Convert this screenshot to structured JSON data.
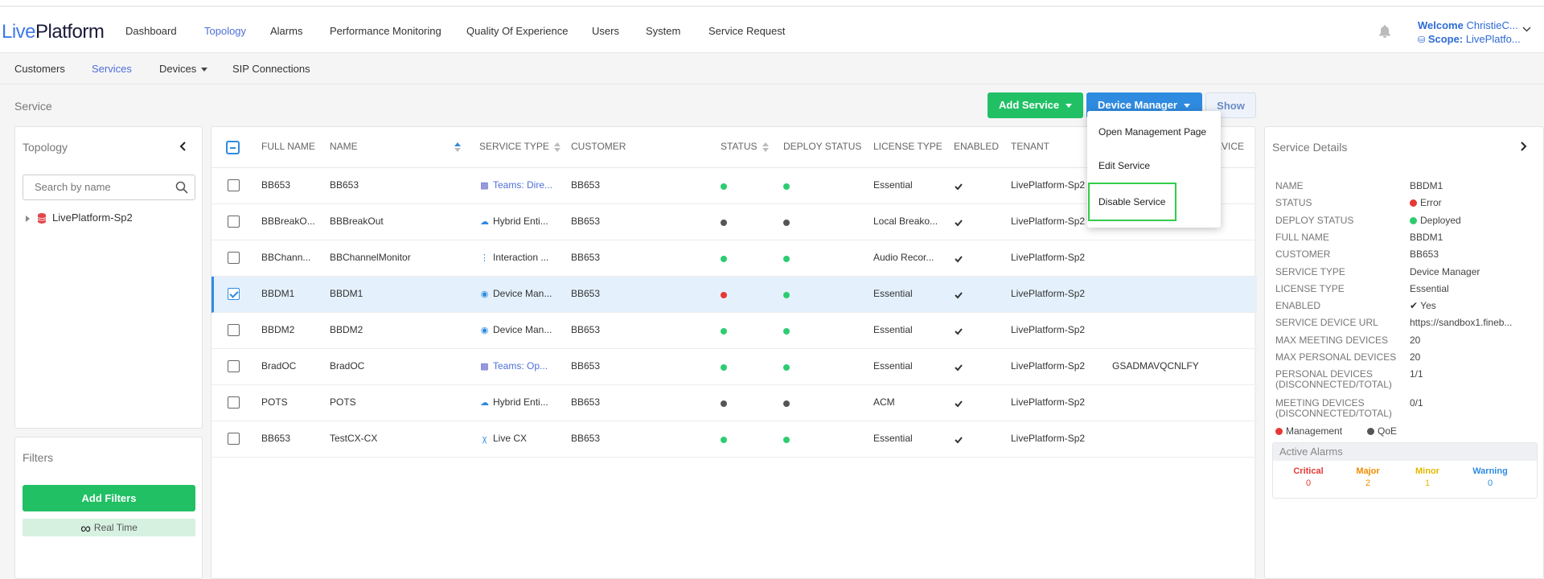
{
  "app": {
    "logo_part1": "Live",
    "logo_part2": "Platform"
  },
  "nav": {
    "items": [
      "Dashboard",
      "Topology",
      "Alarms",
      "Performance Monitoring",
      "Quality Of Experience",
      "Users",
      "System",
      "Service Request"
    ],
    "active": "Topology"
  },
  "user": {
    "welcome_label": "Welcome",
    "name": "ChristieC...",
    "scope_label": "Scope:",
    "scope_value": "LivePlatfo..."
  },
  "subnav": {
    "items": [
      "Customers",
      "Services",
      "Devices",
      "SIP Connections"
    ],
    "active": "Services"
  },
  "page": {
    "title": "Service"
  },
  "toolbar": {
    "add_service": "Add Service",
    "device_manager": "Device Manager",
    "show": "Show"
  },
  "dropdown": {
    "items": [
      "Open Management Page",
      "Edit Service",
      "Disable Service"
    ],
    "highlighted": "Disable Service"
  },
  "topology": {
    "title": "Topology",
    "search_placeholder": "Search by name",
    "tree_root": "LivePlatform-Sp2"
  },
  "filters": {
    "title": "Filters",
    "add_filters": "Add Filters",
    "realtime_icon": "∞",
    "realtime": "Real Time"
  },
  "table": {
    "columns": [
      "FULL NAME",
      "NAME",
      "SERVICE TYPE",
      "CUSTOMER",
      "STATUS",
      "DEPLOY STATUS",
      "LICENSE TYPE",
      "ENABLED",
      "TENANT",
      "EVICE"
    ],
    "rows": [
      {
        "full_name": "BB653",
        "name": "BB653",
        "service_type": "Teams: Dire...",
        "service_icon": "teams-icon",
        "service_link": true,
        "customer": "BB653",
        "status": "green",
        "deploy": "green",
        "license": "Essential",
        "enabled": true,
        "tenant": "LivePlatform-Sp2",
        "extra": "",
        "selected": false
      },
      {
        "full_name": "BBBreakO...",
        "name": "BBBreakOut",
        "service_type": "Hybrid Enti...",
        "service_icon": "cloud-icon",
        "service_link": false,
        "customer": "BB653",
        "status": "gray",
        "deploy": "gray",
        "license": "Local Breako...",
        "enabled": true,
        "tenant": "LivePlatform-Sp2",
        "extra": "",
        "selected": false
      },
      {
        "full_name": "BBChann...",
        "name": "BBChannelMonitor",
        "service_type": "Interaction ...",
        "service_icon": "waveform-icon",
        "service_link": false,
        "customer": "BB653",
        "status": "green",
        "deploy": "green",
        "license": "Audio Recor...",
        "enabled": true,
        "tenant": "LivePlatform-Sp2",
        "extra": "",
        "selected": false
      },
      {
        "full_name": "BBDM1",
        "name": "BBDM1",
        "service_type": "Device Man...",
        "service_icon": "device-manager-icon",
        "service_link": false,
        "customer": "BB653",
        "status": "red",
        "deploy": "green",
        "license": "Essential",
        "enabled": true,
        "tenant": "LivePlatform-Sp2",
        "extra": "",
        "selected": true
      },
      {
        "full_name": "BBDM2",
        "name": "BBDM2",
        "service_type": "Device Man...",
        "service_icon": "device-manager-icon",
        "service_link": false,
        "customer": "BB653",
        "status": "green",
        "deploy": "green",
        "license": "Essential",
        "enabled": true,
        "tenant": "LivePlatform-Sp2",
        "extra": "",
        "selected": false
      },
      {
        "full_name": "BradOC",
        "name": "BradOC",
        "service_type": "Teams: Op...",
        "service_icon": "teams-icon",
        "service_link": true,
        "customer": "BB653",
        "status": "green",
        "deploy": "green",
        "license": "Essential",
        "enabled": true,
        "tenant": "LivePlatform-Sp2",
        "extra": "GSADMAVQCNLFY",
        "selected": false
      },
      {
        "full_name": "POTS",
        "name": "POTS",
        "service_type": "Hybrid Enti...",
        "service_icon": "cloud-icon",
        "service_link": false,
        "customer": "BB653",
        "status": "gray",
        "deploy": "gray",
        "license": "ACM",
        "enabled": true,
        "tenant": "LivePlatform-Sp2",
        "extra": "",
        "selected": false
      },
      {
        "full_name": "BB653",
        "name": "TestCX-CX",
        "service_type": "Live CX",
        "service_icon": "cx-icon",
        "service_link": false,
        "customer": "BB653",
        "status": "green",
        "deploy": "green",
        "license": "Essential",
        "enabled": true,
        "tenant": "LivePlatform-Sp2",
        "extra": "",
        "selected": false
      }
    ]
  },
  "details": {
    "title": "Service Details",
    "fields": [
      {
        "label": "NAME",
        "value": "BBDM1"
      },
      {
        "label": "STATUS",
        "value": "Error",
        "dot": "red"
      },
      {
        "label": "DEPLOY STATUS",
        "value": "Deployed",
        "dot": "green"
      },
      {
        "label": "FULL NAME",
        "value": "BBDM1"
      },
      {
        "label": "CUSTOMER",
        "value": "BB653"
      },
      {
        "label": "SERVICE TYPE",
        "value": "Device Manager"
      },
      {
        "label": "LICENSE TYPE",
        "value": "Essential"
      },
      {
        "label": "ENABLED",
        "value": "Yes",
        "check": true
      },
      {
        "label": "SERVICE DEVICE URL",
        "value": "https://sandbox1.fineb..."
      },
      {
        "label": "MAX MEETING DEVICES",
        "value": "20"
      },
      {
        "label": "MAX PERSONAL DEVICES",
        "value": "20"
      },
      {
        "label": "PERSONAL DEVICES",
        "label2": "(DISCONNECTED/TOTAL)",
        "value": "1/1"
      },
      {
        "label": "MEETING DEVICES",
        "label2": "(DISCONNECTED/TOTAL)",
        "value": "0/1"
      }
    ],
    "legend": [
      {
        "label": "Management",
        "color": "#e53935"
      },
      {
        "label": "QoE",
        "color": "#555555"
      }
    ],
    "alarms": {
      "title": "Active Alarms",
      "items": [
        {
          "label": "Critical",
          "count": "0",
          "color": "#e53935"
        },
        {
          "label": "Major",
          "count": "2",
          "color": "#f08c00"
        },
        {
          "label": "Minor",
          "count": "1",
          "color": "#e5b800"
        },
        {
          "label": "Warning",
          "count": "0",
          "color": "#2f8be0"
        }
      ]
    }
  },
  "colors": {
    "green": "#21c065",
    "blue": "#2f8be0",
    "link": "#4e6fd9",
    "status_green": "#2ecc71",
    "status_gray": "#555555",
    "status_red": "#e53935"
  }
}
